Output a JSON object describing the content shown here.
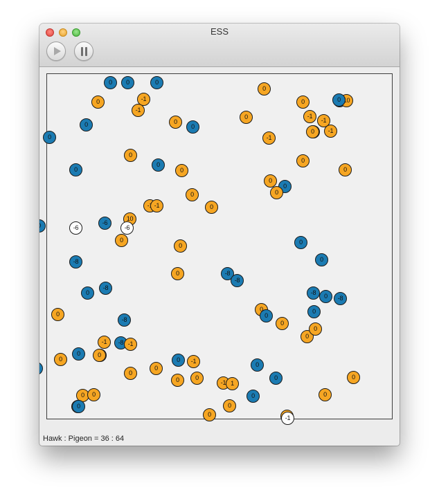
{
  "window": {
    "title": "ESS"
  },
  "toolbar": {
    "play_icon": "play-icon",
    "pause_icon": "pause-icon"
  },
  "colors": {
    "hawk": "#1b7bb2",
    "pigeon": "#f6a623",
    "neutral": "#ffffff",
    "field": "#f0f0f0"
  },
  "agents": [
    {
      "label": "0",
      "type": "hawk"
    },
    {
      "label": "0",
      "type": "hawk"
    },
    {
      "label": "-1",
      "type": "pigeon"
    },
    {
      "label": "-1",
      "type": "pigeon"
    },
    {
      "label": "0",
      "type": "pigeon"
    },
    {
      "label": "0",
      "type": "pigeon"
    },
    {
      "label": "-10",
      "type": "hawk"
    },
    {
      "label": "10",
      "type": "pigeon"
    },
    {
      "label": "0",
      "type": "pigeon"
    },
    {
      "label": "-1",
      "type": "pigeon"
    },
    {
      "label": "-1",
      "type": "pigeon"
    },
    {
      "label": "-1",
      "type": "pigeon"
    },
    {
      "label": "-1",
      "type": "pigeon"
    },
    {
      "label": "0",
      "type": "hawk"
    },
    {
      "label": "0",
      "type": "pigeon"
    },
    {
      "label": "0",
      "type": "hawk"
    },
    {
      "label": "0",
      "type": "pigeon"
    },
    {
      "label": "0",
      "type": "hawk"
    },
    {
      "label": "-1",
      "type": "pigeon"
    },
    {
      "label": "0",
      "type": "hawk"
    },
    {
      "label": "0",
      "type": "pigeon"
    },
    {
      "label": "0",
      "type": "pigeon"
    },
    {
      "label": "0",
      "type": "pigeon"
    },
    {
      "label": "0",
      "type": "hawk"
    },
    {
      "label": "0",
      "type": "hawk"
    },
    {
      "label": "0",
      "type": "pigeon"
    },
    {
      "label": "0",
      "type": "pigeon"
    },
    {
      "label": "0",
      "type": "pigeon"
    },
    {
      "label": "0",
      "type": "pigeon"
    },
    {
      "label": "0",
      "type": "pigeon"
    },
    {
      "label": "0",
      "type": "hawk"
    },
    {
      "label": "0",
      "type": "pigeon"
    },
    {
      "label": "-1",
      "type": "pigeon"
    },
    {
      "label": "-1",
      "type": "pigeon"
    },
    {
      "label": "0",
      "type": "pigeon"
    },
    {
      "label": "0",
      "type": "pigeon"
    },
    {
      "label": "0",
      "type": "hawk"
    },
    {
      "label": "-6",
      "type": "neutral"
    },
    {
      "label": "-6",
      "type": "hawk"
    },
    {
      "label": "10",
      "type": "pigeon"
    },
    {
      "label": "-6",
      "type": "neutral"
    },
    {
      "label": "0",
      "type": "pigeon"
    },
    {
      "label": "0",
      "type": "pigeon"
    },
    {
      "label": "0",
      "type": "hawk"
    },
    {
      "label": "-8",
      "type": "hawk"
    },
    {
      "label": "0",
      "type": "hawk"
    },
    {
      "label": "0",
      "type": "pigeon"
    },
    {
      "label": "-8",
      "type": "hawk"
    },
    {
      "label": "-8",
      "type": "hawk"
    },
    {
      "label": "0",
      "type": "hawk"
    },
    {
      "label": "-8",
      "type": "hawk"
    },
    {
      "label": "-8",
      "type": "hawk"
    },
    {
      "label": "0",
      "type": "hawk"
    },
    {
      "label": "-8",
      "type": "hawk"
    },
    {
      "label": "0",
      "type": "hawk"
    },
    {
      "label": "10",
      "type": "pigeon"
    },
    {
      "label": "0",
      "type": "pigeon"
    },
    {
      "label": "0",
      "type": "pigeon"
    },
    {
      "label": "0",
      "type": "hawk"
    },
    {
      "label": "0",
      "type": "hawk"
    },
    {
      "label": "-8",
      "type": "hawk"
    },
    {
      "label": "0",
      "type": "pigeon"
    },
    {
      "label": "0",
      "type": "pigeon"
    },
    {
      "label": "0",
      "type": "pigeon"
    },
    {
      "label": "0",
      "type": "pigeon"
    },
    {
      "label": "-1",
      "type": "pigeon"
    },
    {
      "label": "-8",
      "type": "hawk"
    },
    {
      "label": "-1",
      "type": "pigeon"
    },
    {
      "label": "0",
      "type": "pigeon"
    },
    {
      "label": "0",
      "type": "pigeon"
    },
    {
      "label": "0",
      "type": "hawk"
    },
    {
      "label": "0",
      "type": "pigeon"
    },
    {
      "label": "0",
      "type": "hawk"
    },
    {
      "label": "0",
      "type": "pigeon"
    },
    {
      "label": "0",
      "type": "hawk"
    },
    {
      "label": "-1",
      "type": "pigeon"
    },
    {
      "label": "0",
      "type": "pigeon"
    },
    {
      "label": "0",
      "type": "pigeon"
    },
    {
      "label": "0",
      "type": "pigeon"
    },
    {
      "label": "0",
      "type": "hawk"
    },
    {
      "label": "-1",
      "type": "pigeon"
    },
    {
      "label": "1",
      "type": "pigeon"
    },
    {
      "label": "0",
      "type": "hawk"
    },
    {
      "label": "0",
      "type": "pigeon"
    },
    {
      "label": "0",
      "type": "pigeon"
    },
    {
      "label": "0",
      "type": "pigeon"
    },
    {
      "label": "0",
      "type": "pigeon"
    },
    {
      "label": "0",
      "type": "hawk"
    },
    {
      "label": "0",
      "type": "pigeon"
    },
    {
      "label": "0",
      "type": "pigeon"
    },
    {
      "label": "0",
      "type": "pigeon"
    },
    {
      "label": "-1",
      "type": "neutral"
    },
    {
      "label": "0",
      "type": "pigeon"
    },
    {
      "label": "0",
      "type": "pigeon"
    },
    {
      "label": "0",
      "type": "hawk"
    },
    {
      "label": "0",
      "type": "hawk"
    }
  ],
  "status": {
    "text": "Hawk : Pigeon = 36 : 64"
  }
}
